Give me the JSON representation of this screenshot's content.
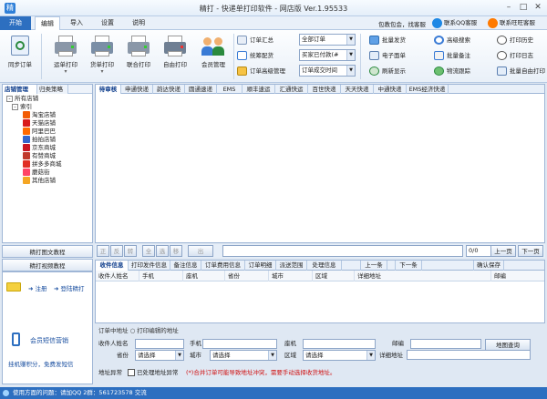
{
  "window": {
    "title": "精打 - 快递单打印软件 - 网店版 Ver.1.95533",
    "minimize": "–",
    "maximize": "□",
    "close": "✕"
  },
  "menu": {
    "items": [
      "开始",
      "编辑",
      "导入",
      "设置",
      "说明"
    ],
    "promo": "包教包会，找客服",
    "qq_service": "联系QQ客服",
    "wangwang_service": "联系旺旺客服"
  },
  "ribbon": {
    "sync_orders": "同步订单",
    "waybill_print": "运单打印",
    "goods_print": "货单打印",
    "combined_print": "联合打印",
    "free_print": "自由打印",
    "member_mgmt": "会员管理",
    "order_summary": "订单汇总",
    "stocking": "统筹配货",
    "order_advanced": "订单高级管理",
    "filter_all_orders": "全部订单",
    "filter_paid": "买家已付款(#",
    "filter_time": "订单成交时间",
    "batch_ship": "批量发货",
    "e_waybill": "电子面单",
    "refresh": "刷新显示",
    "advanced_search": "高级搜索",
    "batch_note": "批量备注",
    "logistics_track": "物流跟踪",
    "print_history": "打印历史",
    "print_log": "打印日志",
    "batch_custom_print": "批量自由打印"
  },
  "left_panel": {
    "tabs": [
      "店铺管理",
      "归类策略"
    ],
    "tree_root": "所有店铺",
    "tree_group": "索引",
    "shops": [
      {
        "name": "淘宝店铺",
        "color": "#f25c05"
      },
      {
        "name": "天猫店铺",
        "color": "#d91a1a"
      },
      {
        "name": "阿里巴巴",
        "color": "#ff6a00"
      },
      {
        "name": "拍拍店铺",
        "color": "#3366cc"
      },
      {
        "name": "京东商城",
        "color": "#c81623"
      },
      {
        "name": "有赞商城",
        "color": "#c0392b"
      },
      {
        "name": "拼多多商城",
        "color": "#e02e24"
      },
      {
        "name": "蘑菇街",
        "color": "#ff4466"
      },
      {
        "name": "其他店铺",
        "color": "#f5a623"
      }
    ],
    "tutorial_graphic": "精打图文教程",
    "tutorial_video": "精打视频教程",
    "register": "注册",
    "login": "登陆精打",
    "sms_marketing": "会员短信营销",
    "points_hint": "挂机赚积分，免费发短信"
  },
  "courier_tabs": [
    "待审核",
    "申通快递",
    "韵达快递",
    "圆通速递",
    "EMS",
    "顺丰速运",
    "汇通快运",
    "百世快递",
    "天天快递",
    "中通快递",
    "EMS经济快递"
  ],
  "pager": {
    "buttons": [
      "正",
      "反",
      "转",
      "全",
      "选",
      "移",
      "出"
    ],
    "count": "0/0",
    "prev": "上一页",
    "next": "下一页"
  },
  "detail_tabs": [
    "收件信息",
    "打印发件信息",
    "备注信息",
    "订单费用信息",
    "订单明细",
    "派送范围",
    "处理信息"
  ],
  "detail_actions": {
    "prev": "上一条",
    "next": "下一条",
    "confirm_save": "确认保存"
  },
  "detail_columns": [
    "收件人姓名",
    "手机",
    "座机",
    "省份",
    "城市",
    "区域",
    "详细地址",
    "邮编"
  ],
  "order_address_hint": "订单中地址  ○ 打印编辑的地址",
  "form": {
    "name_label": "收件人姓名",
    "mobile_label": "手机",
    "phone_label": "座机",
    "zip_label": "邮编",
    "map_btn": "地图查询",
    "province_label": "省份",
    "province_value": "请选择",
    "city_label": "城市",
    "city_value": "请选择",
    "district_label": "区域",
    "district_value": "请选择",
    "address_label": "详细地址",
    "abnormal_label": "地址异常",
    "processed_label": "已处理地址异常",
    "warning": "(*)合并订单可能导致地址冲突，需要手动选择收货地址。"
  },
  "status": {
    "text": "使用方面的问题：请加QQ 2群：561723578 交流"
  }
}
